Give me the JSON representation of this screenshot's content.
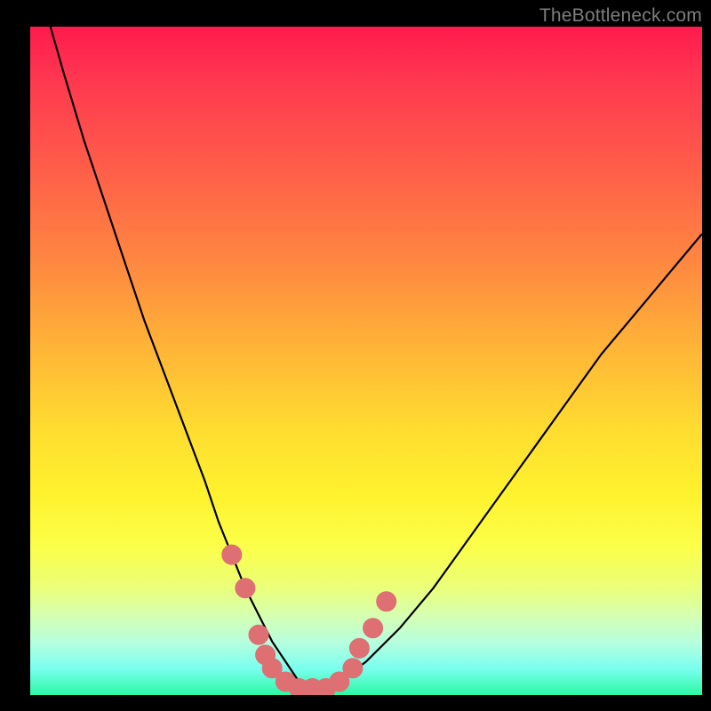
{
  "watermark": "TheBottleneck.com",
  "colors": {
    "background": "#000000",
    "curve": "#000000",
    "marker_fill": "#de6f73",
    "marker_stroke": "#de6f73"
  },
  "chart_data": {
    "type": "line",
    "title": "",
    "xlabel": "",
    "ylabel": "",
    "xlim": [
      0,
      100
    ],
    "ylim": [
      0,
      100
    ],
    "series": [
      {
        "name": "bottleneck-curve",
        "x": [
          3,
          5,
          8,
          11,
          14,
          17,
          20,
          23,
          26,
          28,
          30,
          32,
          34,
          36,
          38,
          40,
          42,
          44,
          46,
          50,
          55,
          60,
          65,
          70,
          75,
          80,
          85,
          90,
          95,
          100
        ],
        "values": [
          100,
          93,
          83,
          74,
          65,
          56,
          48,
          40,
          32,
          26,
          21,
          16,
          12,
          8,
          5,
          2,
          1,
          1,
          2,
          5,
          10,
          16,
          23,
          30,
          37,
          44,
          51,
          57,
          63,
          69
        ]
      }
    ],
    "markers": [
      {
        "x": 30,
        "y": 21
      },
      {
        "x": 32,
        "y": 16
      },
      {
        "x": 34,
        "y": 9
      },
      {
        "x": 35,
        "y": 6
      },
      {
        "x": 36,
        "y": 4
      },
      {
        "x": 38,
        "y": 2
      },
      {
        "x": 40,
        "y": 1
      },
      {
        "x": 42,
        "y": 1
      },
      {
        "x": 44,
        "y": 1
      },
      {
        "x": 46,
        "y": 2
      },
      {
        "x": 48,
        "y": 4
      },
      {
        "x": 49,
        "y": 7
      },
      {
        "x": 51,
        "y": 10
      },
      {
        "x": 53,
        "y": 14
      }
    ],
    "marker_radius": 1.3
  }
}
